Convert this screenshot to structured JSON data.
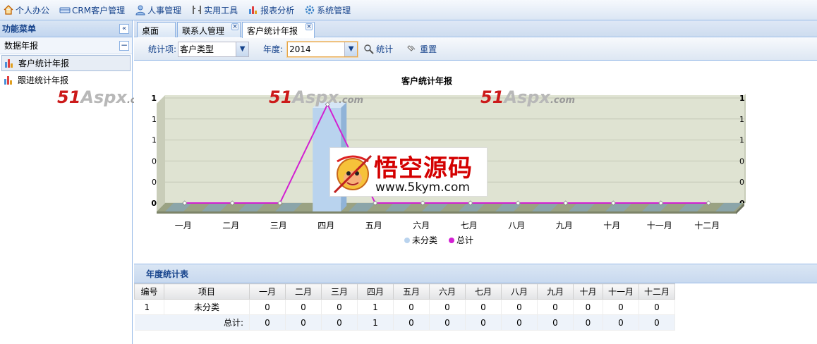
{
  "topbar": {
    "items": [
      {
        "label": "个人办公",
        "icon": "home-icon"
      },
      {
        "label": "CRM客户管理",
        "icon": "card-icon"
      },
      {
        "label": "人事管理",
        "icon": "user-icon"
      },
      {
        "label": "实用工具",
        "icon": "tools-icon"
      },
      {
        "label": "报表分析",
        "icon": "chart-icon"
      },
      {
        "label": "系统管理",
        "icon": "gear-icon"
      }
    ]
  },
  "sidebar": {
    "title": "功能菜单",
    "collapse_glyph": "«",
    "group": "数据年报",
    "group_toggle": "−",
    "items": [
      {
        "label": "客户统计年报",
        "active": true
      },
      {
        "label": "跟进统计年报",
        "active": false
      }
    ]
  },
  "tabs": [
    {
      "label": "桌面",
      "closable": false
    },
    {
      "label": "联系人管理",
      "closable": true
    },
    {
      "label": "客户统计年报",
      "closable": true,
      "active": true
    }
  ],
  "toolbar": {
    "item_label": "统计项:",
    "item_value": "客户类型",
    "year_label": "年度:",
    "year_value": "2014",
    "stat_button": "统计",
    "reset_button": "重置"
  },
  "chart_data": {
    "type": "bar",
    "title": "客户统计年报",
    "categories": [
      "一月",
      "二月",
      "三月",
      "四月",
      "五月",
      "六月",
      "七月",
      "八月",
      "九月",
      "十月",
      "十一月",
      "十二月"
    ],
    "series": [
      {
        "name": "未分类",
        "type": "bar",
        "color": "#b9d3ee",
        "values": [
          0,
          0,
          0,
          1,
          0,
          0,
          0,
          0,
          0,
          0,
          0,
          0
        ]
      },
      {
        "name": "总计",
        "type": "line",
        "color": "#d21fd2",
        "values": [
          0,
          0,
          0,
          1,
          0,
          0,
          0,
          0,
          0,
          0,
          0,
          0
        ]
      }
    ],
    "ylim": [
      0,
      1
    ],
    "y_tick_labels": [
      "0",
      "0",
      "0",
      "1",
      "1",
      "1"
    ],
    "grid": true,
    "legend": "bottom"
  },
  "watermarks": {
    "brand_num": "51",
    "brand_name": "Aspx",
    "brand_dom": ".com",
    "wk_cn": "悟空源码",
    "wk_url": "www.5kym.com"
  },
  "grid": {
    "title": "年度统计表",
    "columns": [
      "编号",
      "项目",
      "一月",
      "二月",
      "三月",
      "四月",
      "五月",
      "六月",
      "七月",
      "八月",
      "九月",
      "十月",
      "十一月",
      "十二月"
    ],
    "rows": [
      [
        "1",
        "未分类",
        "0",
        "0",
        "0",
        "1",
        "0",
        "0",
        "0",
        "0",
        "0",
        "0",
        "0",
        "0"
      ]
    ],
    "summary_label": "总计:",
    "summary": [
      "0",
      "0",
      "0",
      "1",
      "0",
      "0",
      "0",
      "0",
      "0",
      "0",
      "0",
      "0"
    ]
  }
}
